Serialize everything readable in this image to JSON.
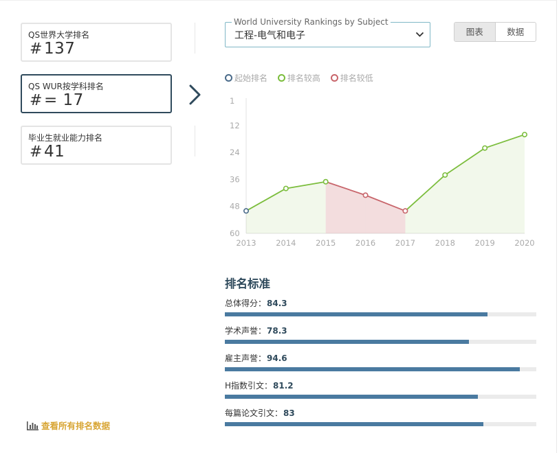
{
  "cards": [
    {
      "label": "QS世界大学排名",
      "hash": "#",
      "value": "137"
    },
    {
      "label": "QS WUR按学科排名",
      "hash": "#",
      "value": "= 17"
    },
    {
      "label": "毕业生就业能力排名",
      "hash": "#",
      "value": "41"
    }
  ],
  "view_all": "查看所有排名数据",
  "subject_select": {
    "legend": "World University Rankings by Subject",
    "value": "工程-电气和电子"
  },
  "toggle": {
    "chart": "图表",
    "data": "数据"
  },
  "colors": {
    "start": "#4a6b8a",
    "higher": "#7bbd3c",
    "lower": "#c8656b",
    "bar": "#4a7aa0"
  },
  "chart_data": {
    "type": "line",
    "legend": [
      "起始排名",
      "排名较高",
      "排名较低"
    ],
    "x": [
      "2013",
      "2014",
      "2015",
      "2016",
      "2017",
      "2018",
      "2019",
      "2020"
    ],
    "y_ticks": [
      "1",
      "12",
      "24",
      "36",
      "48",
      "60"
    ],
    "ylim": [
      1,
      60
    ],
    "y_inverted": true,
    "series": [
      {
        "values": [
          50,
          40,
          37,
          43,
          50,
          34,
          22,
          16
        ],
        "segment_status": [
          "start",
          "higher",
          "higher",
          "lower",
          "lower",
          "higher",
          "higher",
          "higher"
        ]
      }
    ]
  },
  "criteria": {
    "title": "排名标准",
    "items": [
      {
        "label": "总体得分：",
        "value": "84.3",
        "score": 84.3
      },
      {
        "label": "学术声誉：",
        "value": "78.3",
        "score": 78.3
      },
      {
        "label": "雇主声誉：",
        "value": "94.6",
        "score": 94.6
      },
      {
        "label": "H指数引文：",
        "value": "81.2",
        "score": 81.2
      },
      {
        "label": "每篇论文引文：",
        "value": "83",
        "score": 83
      }
    ]
  }
}
